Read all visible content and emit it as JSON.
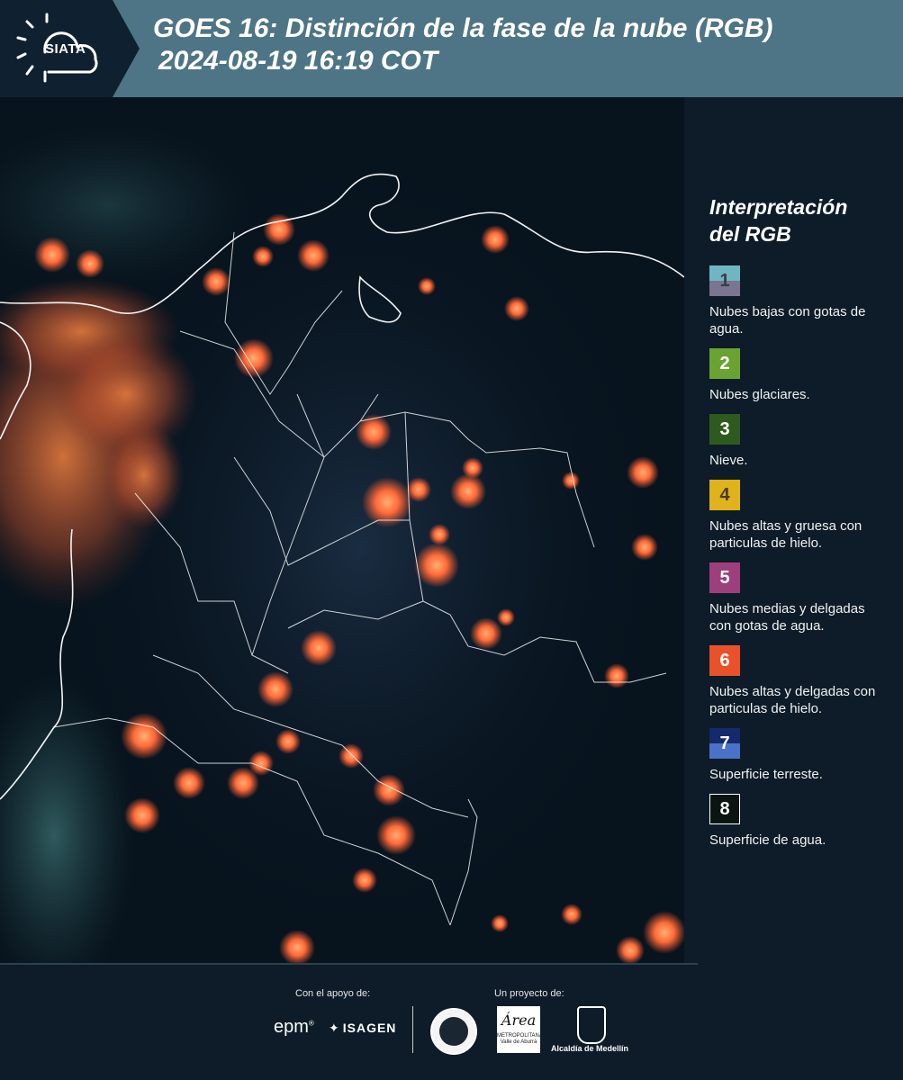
{
  "header": {
    "logo_label": "SIATA",
    "title_line1": "GOES 16: Distinción de la fase de la nube (RGB)",
    "title_line2": "2024-08-19 16:19 COT"
  },
  "legend": {
    "title": "Interpretación del RGB",
    "items": [
      {
        "num": "1",
        "label": "Nubes bajas con gotas de agua.",
        "color_top": "#6fb6c2",
        "color_bottom": "#7a7590",
        "text_color": "#3c3c4a"
      },
      {
        "num": "2",
        "label": "Nubes glaciares.",
        "color_top": "#6aa332",
        "color_bottom": "#6aa332",
        "text_color": "#ffffff"
      },
      {
        "num": "3",
        "label": "Nieve.",
        "color_top": "#2f5a1f",
        "color_bottom": "#2f5a1f",
        "text_color": "#ffffff"
      },
      {
        "num": "4",
        "label": "Nubes altas y gruesa con particulas de hielo.",
        "color_top": "#e0b21c",
        "color_bottom": "#e0b21c",
        "text_color": "#4a3a10"
      },
      {
        "num": "5",
        "label": "Nubes medias y delgadas con gotas de agua.",
        "color_top": "#9e3f7d",
        "color_bottom": "#9e3f7d",
        "text_color": "#ffffff"
      },
      {
        "num": "6",
        "label": "Nubes altas y delgadas con particulas de hielo.",
        "color_top": "#e9512b",
        "color_bottom": "#e9512b",
        "text_color": "#ffffff"
      },
      {
        "num": "7",
        "label": "Superficie terreste.",
        "color_top": "#142a6b",
        "color_bottom": "#4a72c8",
        "text_color": "#ffffff"
      },
      {
        "num": "8",
        "label": "Superficie de agua.",
        "color_top": "#0a1410",
        "color_bottom": "#0a1410",
        "text_color": "#ffffff"
      }
    ]
  },
  "footer": {
    "support_label": "Con el apoyo de:",
    "project_label": "Un proyecto de:",
    "epm": "epm",
    "isagen": "ISAGEN",
    "area_title": "Área",
    "area_sub": "METROPOLITANA Valle de Aburrá",
    "alcaldia": "Alcaldía de Medellín"
  },
  "colors": {
    "header_bg": "#4e7585",
    "panel_bg": "#0d1c28",
    "cloud_orange": "#ff6a3a",
    "map_bg": "#07131d"
  }
}
